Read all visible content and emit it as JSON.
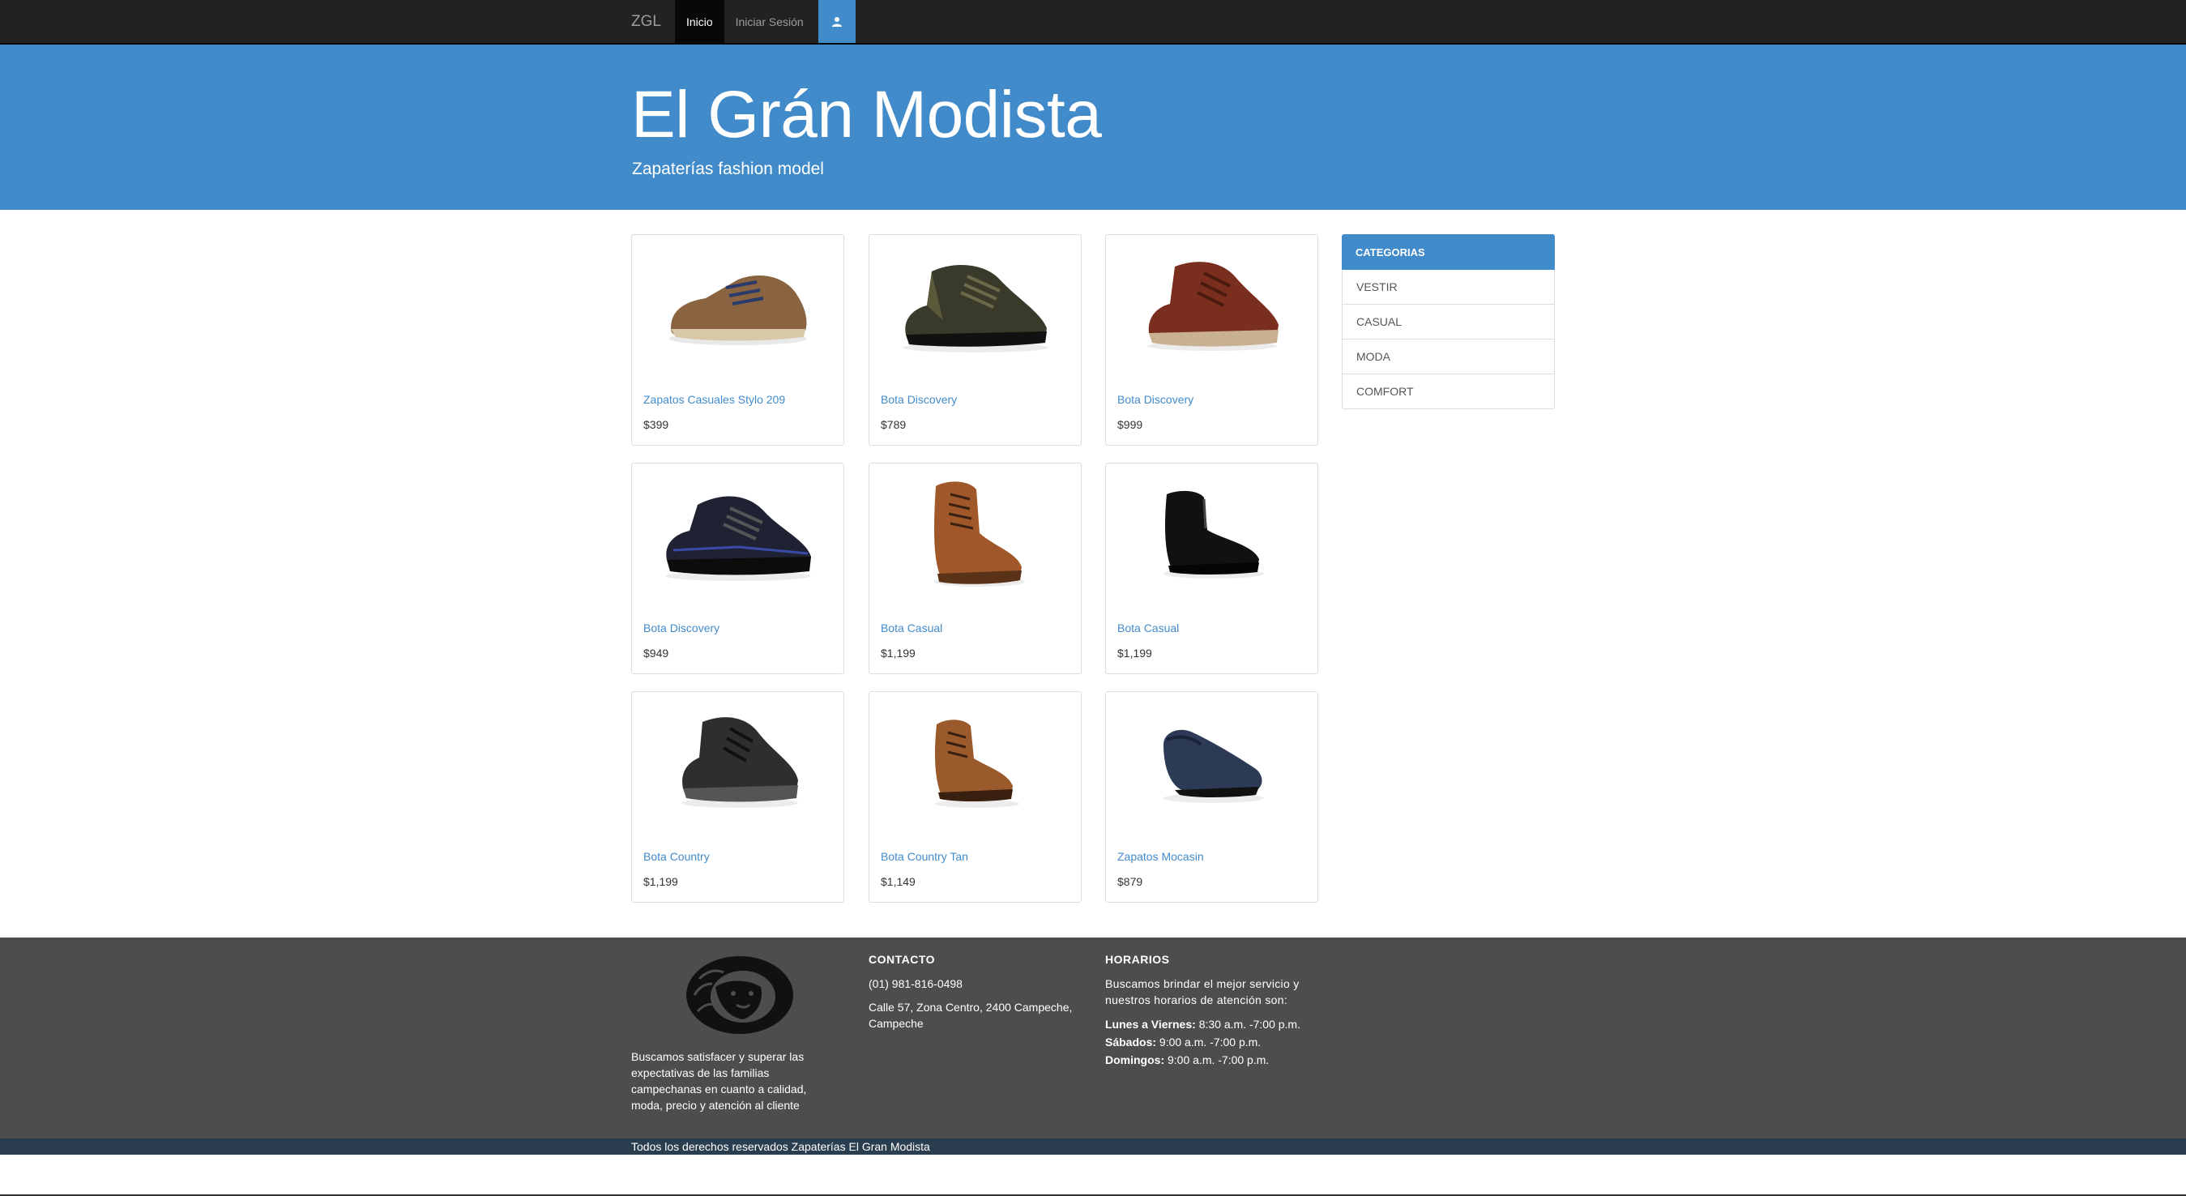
{
  "nav": {
    "brand": "ZGL",
    "items": [
      {
        "label": "Inicio",
        "active": true
      },
      {
        "label": "Iniciar Sesión",
        "active": false
      }
    ],
    "user_icon": "user-icon"
  },
  "jumbotron": {
    "title": "El Grán Modista",
    "subtitle": "Zapaterías fashion model"
  },
  "products": [
    {
      "name": "Zapatos Casuales Stylo 209",
      "price": "$399",
      "image": "brown-leather-sneaker",
      "color": "#8a6440"
    },
    {
      "name": "Bota Discovery",
      "price": "$789",
      "image": "black-olive-hiking-boot",
      "color": "#3a3a2a"
    },
    {
      "name": "Bota Discovery",
      "price": "$999",
      "image": "red-brown-boot",
      "color": "#7a2e1e"
    },
    {
      "name": "Bota Discovery",
      "price": "$949",
      "image": "black-blue-hiking-shoe",
      "color": "#1f2233"
    },
    {
      "name": "Bota Casual",
      "price": "$1,199",
      "image": "tan-lace-boot",
      "color": "#a0582a"
    },
    {
      "name": "Bota Casual",
      "price": "$1,199",
      "image": "black-zip-boot",
      "color": "#111111"
    },
    {
      "name": "Bota Country",
      "price": "$1,199",
      "image": "dark-gray-boot",
      "color": "#2e2e2e"
    },
    {
      "name": "Bota Country Tan",
      "price": "$1,149",
      "image": "tan-country-boot",
      "color": "#9a5a2c"
    },
    {
      "name": "Zapatos Mocasin",
      "price": "$879",
      "image": "navy-moccasin",
      "color": "#2c3a55"
    }
  ],
  "categories": {
    "title": "CATEGORIAS",
    "items": [
      "VESTIR",
      "CASUAL",
      "MODA",
      "COMFORT"
    ]
  },
  "footer": {
    "logo": "lion-head-logo",
    "about": "Buscamos satisfacer y superar las expectativas de las familias campechanas en cuanto a calidad, moda, precio y atención al cliente",
    "contact_title": "CONTACTO",
    "phone": "(01) 981-816-0498",
    "address": "Calle 57, Zona Centro, 2400 Campeche, Campeche",
    "hours_title": "HORARIOS",
    "hours_intro": "Buscamos brindar el mejor servicio y nuestros horarios de atención son:",
    "hours": [
      {
        "day": "Lunes a Viernes:",
        "time": "8:30 a.m. -7:00 p.m."
      },
      {
        "day": "Sábados:",
        "time": "9:00 a.m. -7:00 p.m."
      },
      {
        "day": "Domingos:",
        "time": "9:00 a.m. -7:00 p.m."
      }
    ],
    "copyright": "Todos los derechos reservados Zapaterías El Gran Modista"
  }
}
